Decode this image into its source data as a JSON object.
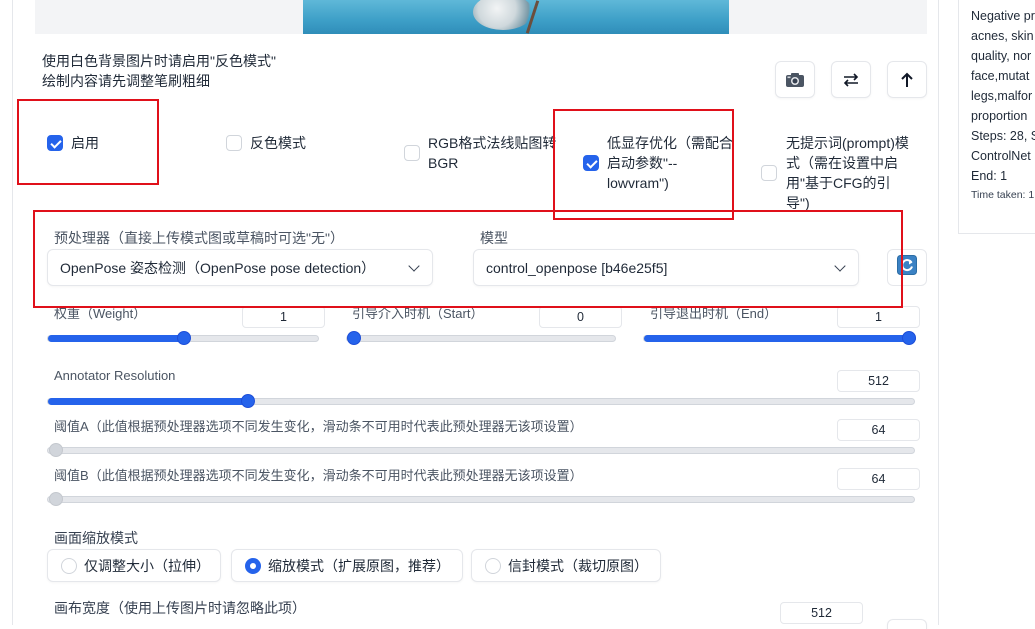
{
  "side_panel": {
    "lines": [
      "Negative pr",
      "acnes, skin",
      "quality, nor",
      "face,mutat",
      "legs,malfor",
      "proportion",
      "Steps: 28, S",
      "ControlNet",
      "End: 1"
    ],
    "time": "Time taken: 1"
  },
  "hints": {
    "line1": "使用白色背景图片时请启用\"反色模式\"",
    "line2": "绘制内容请先调整笔刷粗细"
  },
  "toolbar": {
    "camera_icon": "camera-icon",
    "swap_icon": "swap-arrows-icon",
    "upload_icon": "arrow-up-icon"
  },
  "checkboxes": {
    "enable": {
      "label": "启用",
      "checked": true
    },
    "invert": {
      "label": "反色模式",
      "checked": false
    },
    "rgb_bgr": {
      "label1": "RGB格式法线贴图转",
      "label2": "BGR",
      "checked": false
    },
    "lowvram": {
      "label1": "低显存优化（需配合",
      "label2": "启动参数\"--",
      "label3": "lowvram\")",
      "checked": true
    },
    "guess": {
      "label1": "无提示词(prompt)模",
      "label2": "式（需在设置中启",
      "label3": "用\"基于CFG的引",
      "label4": "导\")",
      "checked": false
    }
  },
  "preprocessor": {
    "label": "预处理器（直接上传模式图或草稿时可选\"无\"）",
    "value": "OpenPose 姿态检测（OpenPose pose detection）"
  },
  "model": {
    "label": "模型",
    "value": "control_openpose [b46e25f5]"
  },
  "sliders": {
    "weight": {
      "label": "权重（Weight）",
      "value": "1",
      "min": 0,
      "max": 2,
      "v": 1
    },
    "start": {
      "label": "引导介入时机（Start）",
      "value": "0",
      "min": 0,
      "max": 1,
      "v": 0
    },
    "end": {
      "label": "引导退出时机（End）",
      "value": "1",
      "min": 0,
      "max": 1,
      "v": 1
    },
    "annotator": {
      "label": "Annotator Resolution",
      "value": "512",
      "min": 64,
      "max": 2048,
      "v": 512
    },
    "threshold_a": {
      "label": "阈值A（此值根据预处理器选项不同发生变化，滑动条不可用时代表此预处理器无该项设置）",
      "value": "64"
    },
    "threshold_b": {
      "label": "阈值B（此值根据预处理器选项不同发生变化，滑动条不可用时代表此预处理器无该项设置）",
      "value": "64"
    }
  },
  "resize_mode": {
    "label": "画面缩放模式",
    "options": [
      "仅调整大小（拉伸）",
      "缩放模式（扩展原图，推荐）",
      "信封模式（裁切原图）"
    ],
    "selected_index": 1
  },
  "canvas_width": {
    "label": "画布宽度（使用上传图片时请忽略此项）",
    "value": "512"
  }
}
